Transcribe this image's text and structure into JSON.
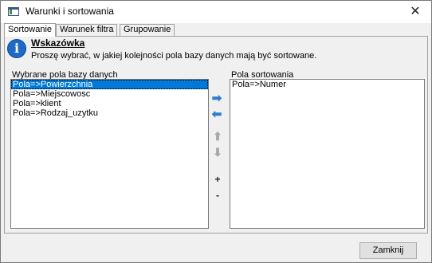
{
  "window": {
    "title": "Warunki i sortowania",
    "close_glyph": "✕"
  },
  "tabs": [
    {
      "label": "Sortowanie",
      "active": true
    },
    {
      "label": "Warunek filtra",
      "active": false
    },
    {
      "label": "Grupowanie",
      "active": false
    }
  ],
  "hint": {
    "icon": "info-icon",
    "icon_glyph": "i",
    "title": "Wskazówka",
    "text": "Proszę wybrać, w jakiej kolejności pola bazy danych mają być sortowane."
  },
  "left_list": {
    "label": "Wybrane pola bazy danych",
    "items": [
      {
        "text": "Pola=>Powierzchnia",
        "selected": true
      },
      {
        "text": "Pola=>Miejscowosc",
        "selected": false
      },
      {
        "text": "Pola=>klient",
        "selected": false
      },
      {
        "text": "Pola=>Rodzaj_uzytku",
        "selected": false
      }
    ]
  },
  "right_list": {
    "label": "Pola sortowania",
    "items": [
      {
        "text": "Pola=>Numer",
        "selected": false
      }
    ]
  },
  "controls": {
    "move_right_glyph": "➡",
    "move_left_glyph": "⬅",
    "move_up_glyph": "⬆",
    "move_down_glyph": "⬇",
    "ascending_label": "+",
    "descending_label": "-",
    "enabled_color": "#2f7bd1",
    "disabled_color": "#a8a8a8"
  },
  "footer": {
    "close_label": "Zamknij"
  }
}
